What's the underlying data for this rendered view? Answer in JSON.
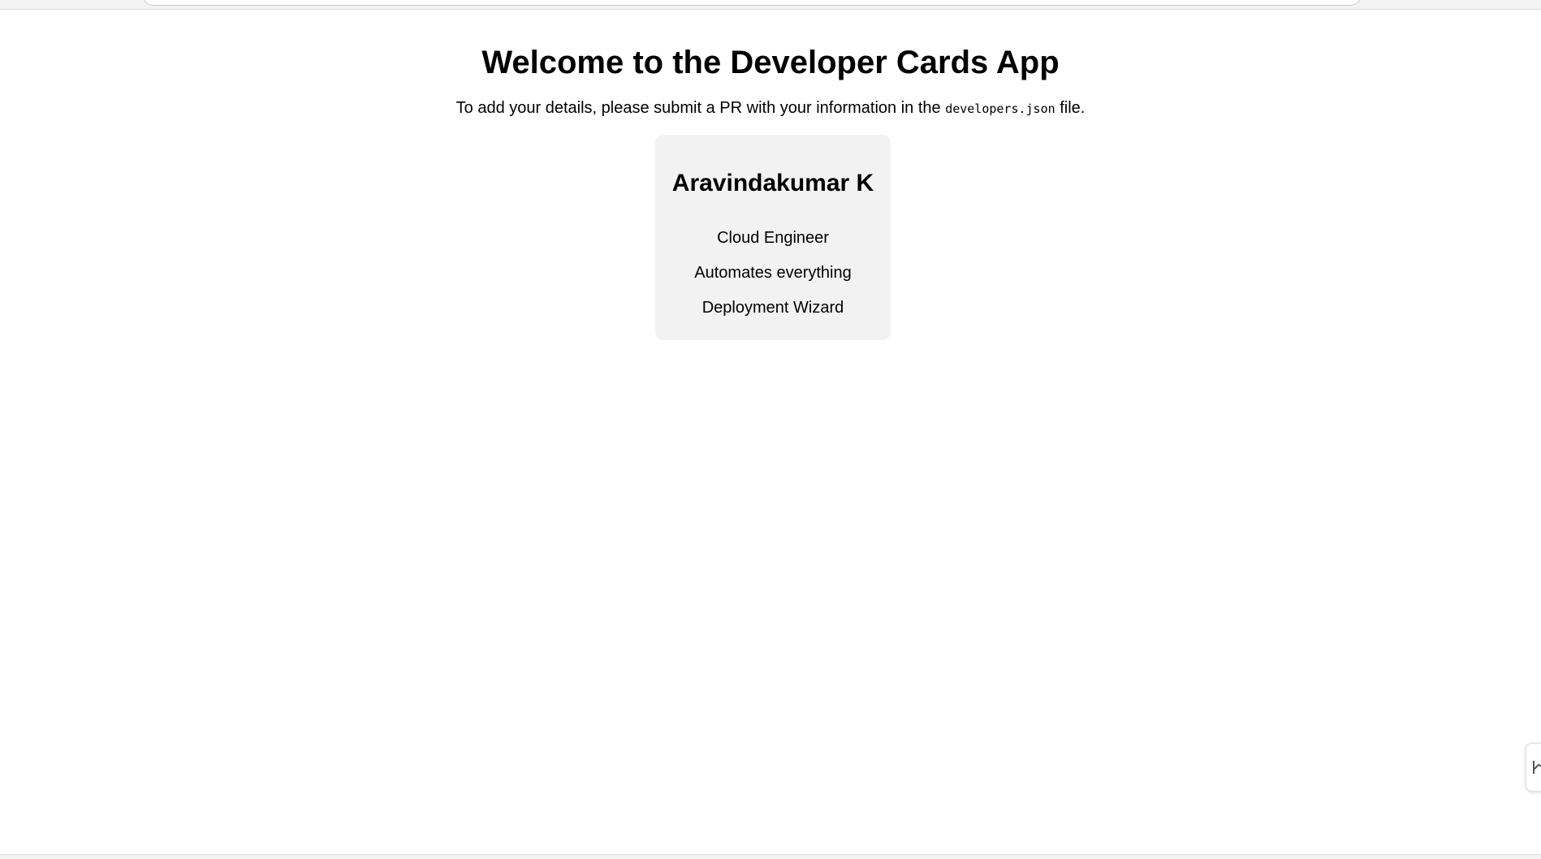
{
  "page": {
    "title": "Welcome to the Developer Cards App",
    "intro_before": "To add your details, please submit a PR with your information in the ",
    "intro_code": "developers.json",
    "intro_after": " file."
  },
  "developers": [
    {
      "name": "Aravindakumar K",
      "role": "Cloud Engineer",
      "bio": "Automates everything",
      "title": "Deployment Wizard"
    }
  ],
  "colors": {
    "card_background": "#f2f2f2",
    "text": "#000000",
    "page_background": "#ffffff"
  },
  "icons": {
    "side_widget": "chart-line-icon"
  }
}
